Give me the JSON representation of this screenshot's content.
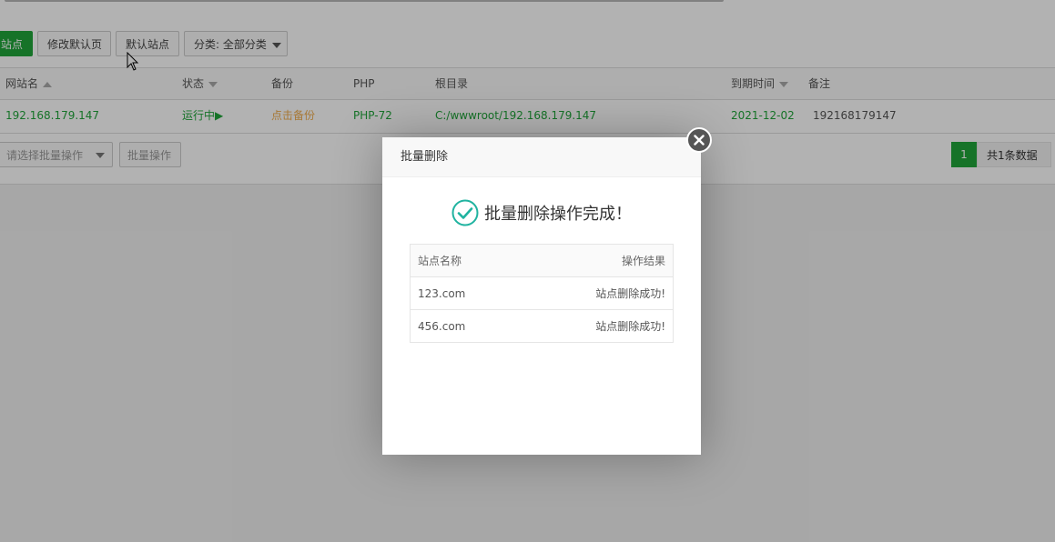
{
  "toolbar": {
    "add_site_label": "站点",
    "modify_default_page_label": "修改默认页",
    "default_site_label": "默认站点",
    "category_label": "分类: 全部分类"
  },
  "table": {
    "headers": {
      "site_name": "网站名",
      "status": "状态",
      "backup": "备份",
      "php": "PHP",
      "root_dir": "根目录",
      "expire_time": "到期时间",
      "remark": "备注"
    },
    "rows": [
      {
        "site_name": "192.168.179.147",
        "status": "运行中▶",
        "backup": "点击备份",
        "php": "PHP-72",
        "root_dir": "C:/wwwroot/192.168.179.147",
        "expire_time": "2021-12-02",
        "remark": "192168179147"
      }
    ]
  },
  "footer": {
    "batch_select_placeholder": "请选择批量操作",
    "batch_button_label": "批量操作",
    "current_page": "1",
    "total_label": "共1条数据"
  },
  "modal": {
    "title": "批量删除",
    "success_message": "批量删除操作完成！",
    "columns": {
      "site_name": "站点名称",
      "result": "操作结果"
    },
    "results": [
      {
        "site_name": "123.com",
        "result": "站点删除成功!"
      },
      {
        "site_name": "456.com",
        "result": "站点删除成功!"
      }
    ]
  },
  "colors": {
    "accent_green": "#20a53a",
    "backup_orange": "#f0ad4e",
    "check_teal": "#20b3a0"
  }
}
